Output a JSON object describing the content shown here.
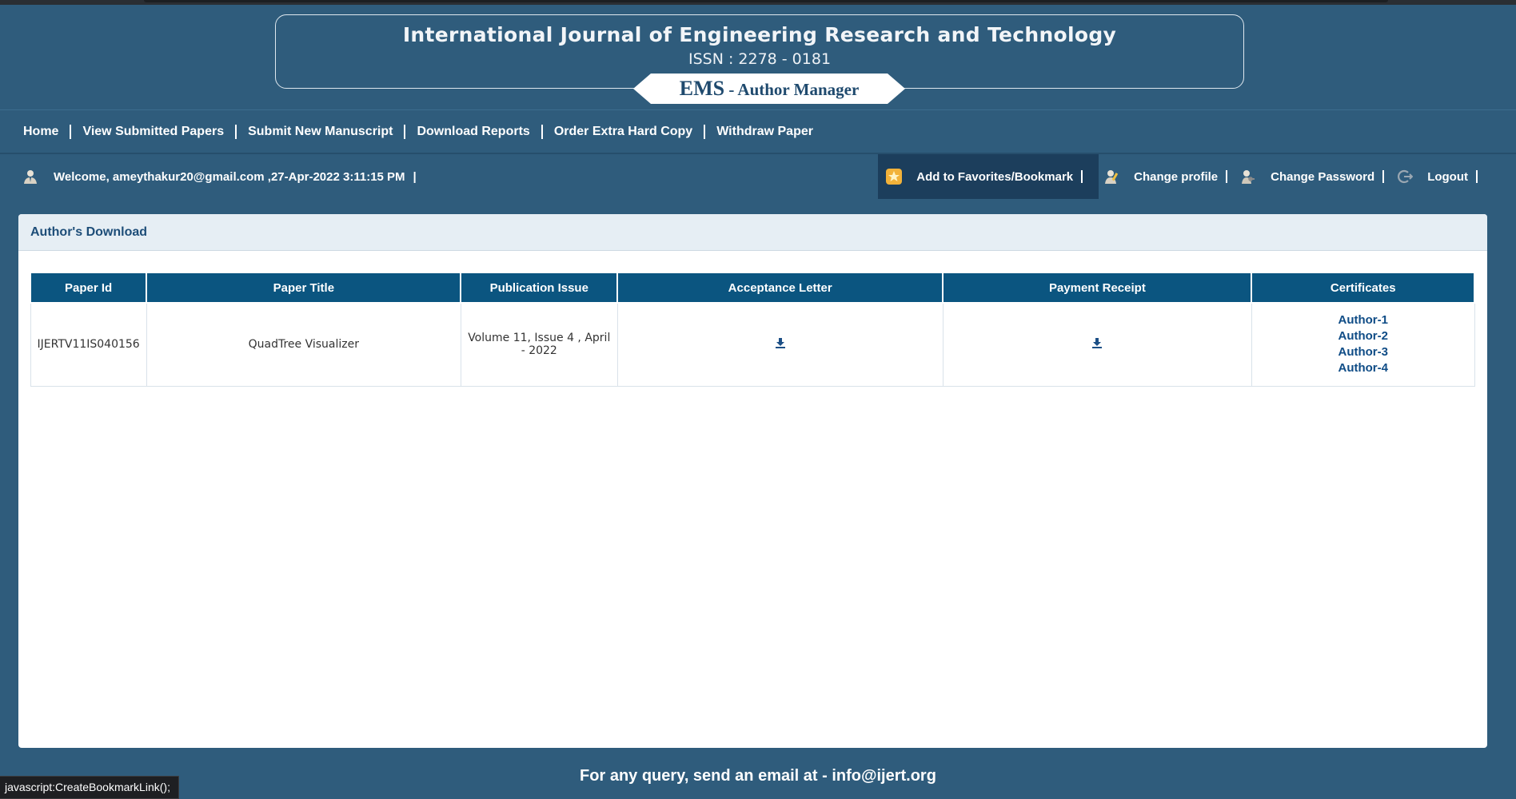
{
  "header": {
    "title": "International Journal of Engineering Research and Technology",
    "issn": "ISSN : 2278 - 0181",
    "ems": "EMS",
    "ems_sub": " - Author Manager"
  },
  "nav": {
    "items": [
      {
        "label": "Home"
      },
      {
        "label": "View Submitted Papers"
      },
      {
        "label": "Submit New Manuscript"
      },
      {
        "label": "Download Reports"
      },
      {
        "label": "Order Extra Hard Copy"
      },
      {
        "label": "Withdraw Paper"
      }
    ]
  },
  "userbar": {
    "welcome": "Welcome, ameythakur20@gmail.com ,27-Apr-2022 3:11:15 PM",
    "pipe": "|",
    "favorites": "Add to Favorites/Bookmark",
    "change_profile": "Change profile",
    "change_password": "Change Password",
    "logout": "Logout"
  },
  "panel": {
    "title": "Author's Download",
    "columns": [
      "Paper Id",
      "Paper Title",
      "Publication Issue",
      "Acceptance Letter",
      "Payment Receipt",
      "Certificates"
    ],
    "rows": [
      {
        "paper_id": "IJERTV11IS040156",
        "paper_title": "QuadTree Visualizer",
        "publication_issue": "Volume 11, Issue 4 , April - 2022",
        "acceptance_letter_icon": "download-icon",
        "payment_receipt_icon": "download-icon",
        "certificates": [
          "Author-1",
          "Author-2",
          "Author-3",
          "Author-4"
        ]
      }
    ]
  },
  "footer": {
    "query": "For any query, send an email at - info@ijert.org"
  },
  "statusbar": {
    "text": "javascript:CreateBookmarkLink();"
  },
  "colors": {
    "page_bg": "#2f5c7c",
    "table_header": "#0b5580",
    "link": "#0f4c86",
    "favorites_bg": "#1c3e5c"
  }
}
